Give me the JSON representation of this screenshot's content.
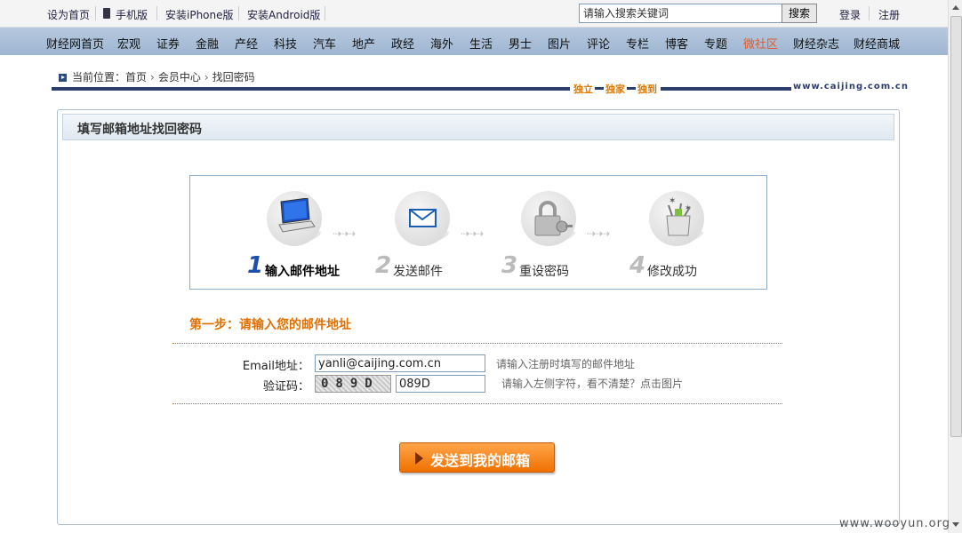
{
  "topbar": {
    "set_home": "设为首页",
    "mobile": "手机版",
    "iphone": "安装iPhone版",
    "android": "安装Android版",
    "search_placeholder": "请输入搜索关键词",
    "search_button": "搜索",
    "login": "登录",
    "register": "注册"
  },
  "nav": [
    "财经网首页",
    "宏观",
    "证券",
    "金融",
    "产经",
    "科技",
    "汽车",
    "地产",
    "政经",
    "海外",
    "生活",
    "男士",
    "图片",
    "评论",
    "专栏",
    "博客",
    "专题",
    "微社区",
    "财经杂志",
    "财经商城"
  ],
  "nav_highlight_color": "#e05a2a",
  "breadcrumb": {
    "prefix": "当前位置：",
    "home": "首页",
    "member": "会员中心",
    "current": "找回密码"
  },
  "slogan": [
    "独立",
    "独家",
    "独到"
  ],
  "site_url": "www.caijing.com.cn",
  "panel_title": "填写邮箱地址找回密码",
  "steps": [
    {
      "num": "1",
      "label": "输入邮件地址",
      "icon": "computer-icon",
      "active": true
    },
    {
      "num": "2",
      "label": "发送邮件",
      "icon": "envelope-icon",
      "active": false
    },
    {
      "num": "3",
      "label": "重设密码",
      "icon": "lock-icon",
      "active": false
    },
    {
      "num": "4",
      "label": "修改成功",
      "icon": "gift-box-icon",
      "active": false
    }
  ],
  "step_heading": "第一步：请输入您的邮件地址",
  "form": {
    "email_label": "Email地址：",
    "email_value": "yanli@caijing.com.cn",
    "email_hint": "请输入注册时填写的邮件地址",
    "captcha_label": "验证码：",
    "captcha_image_text": "089D",
    "captcha_value": "089D",
    "captcha_hint": "请输入左侧字符，看不清楚？点击图片"
  },
  "send_button": "发送到我的邮箱",
  "watermark": "www.wooyun.org"
}
